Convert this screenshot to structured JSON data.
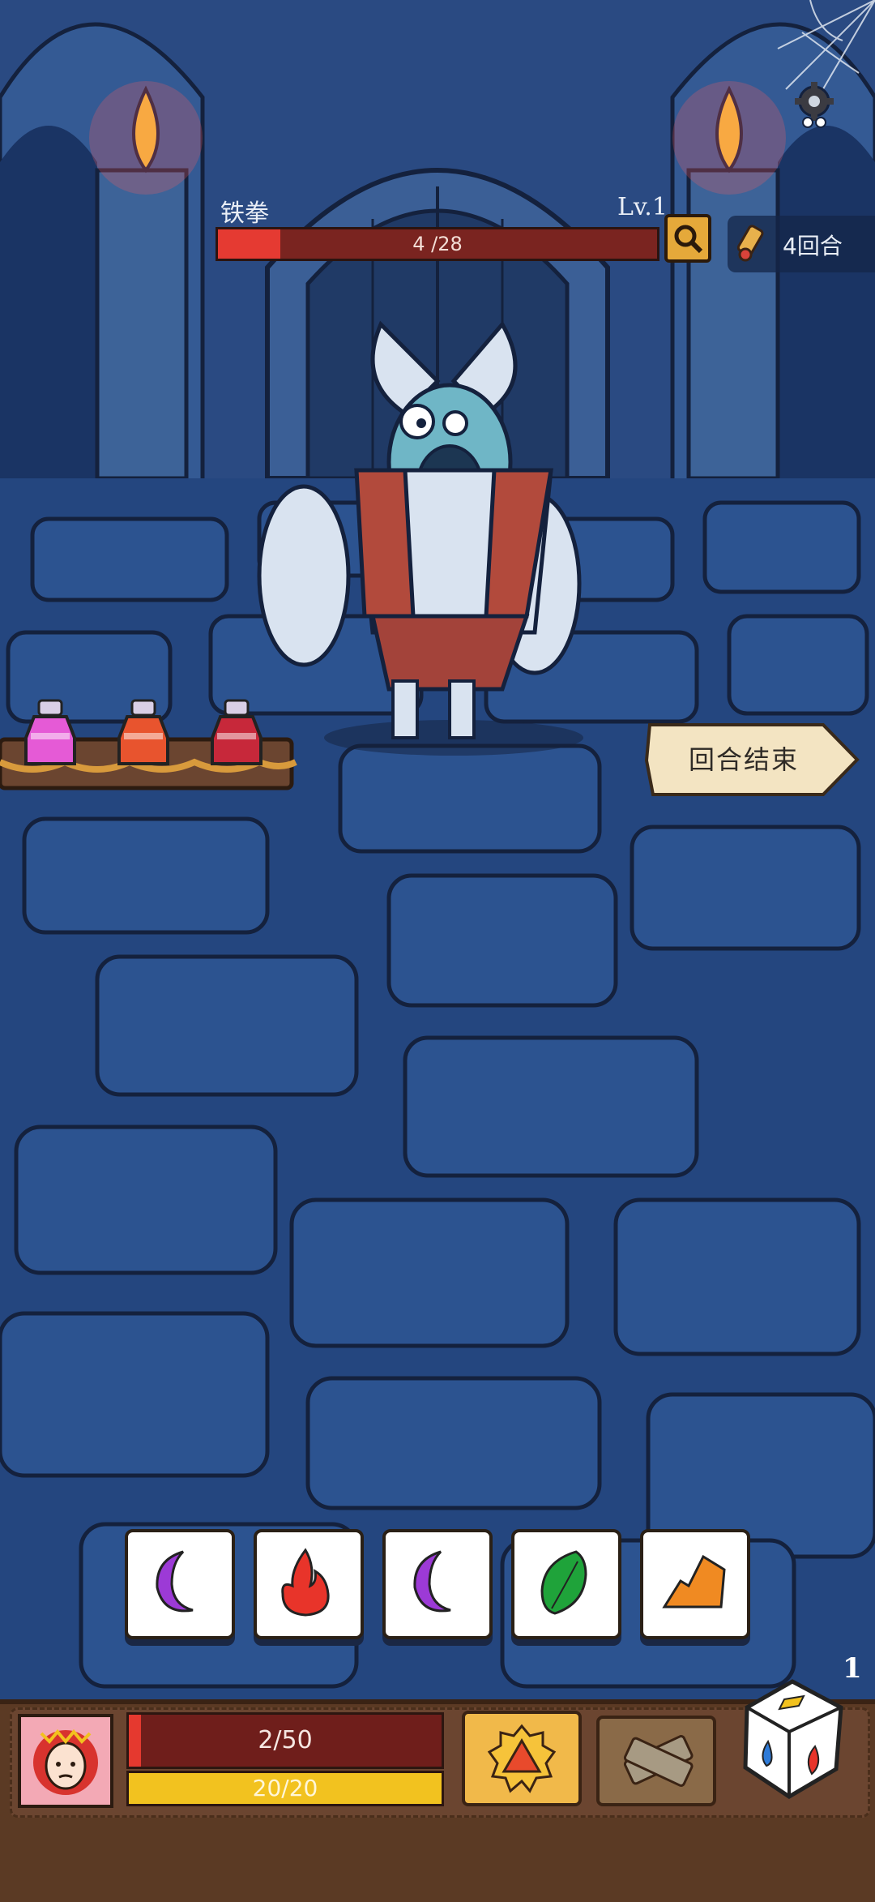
{
  "enemy": {
    "name": "铁拳",
    "level": "Lv.1",
    "hp_text": "4 /28",
    "hp_current": 4,
    "hp_max": 28,
    "hp_color": "#e53a32"
  },
  "rounds": {
    "label": "4回合"
  },
  "end_turn": {
    "label": "回合结束"
  },
  "dice_tiles": [
    {
      "symbol": "moon",
      "color": "#9c3ad6"
    },
    {
      "symbol": "fire",
      "color": "#e8342a"
    },
    {
      "symbol": "moon",
      "color": "#9c3ad6"
    },
    {
      "symbol": "leaf",
      "color": "#1fa33a"
    },
    {
      "symbol": "earth",
      "color": "#f08a22"
    }
  ],
  "potions": [
    {
      "name": "pink-potion",
      "color": "#e55ad6"
    },
    {
      "name": "orange-potion",
      "color": "#e8542e"
    },
    {
      "name": "red-potion",
      "color": "#c7283a"
    }
  ],
  "player": {
    "hp_text": "2/50",
    "hp_current": 2,
    "hp_max": 50,
    "energy_text": "20/20",
    "energy_current": 20,
    "energy_max": 20
  },
  "dice": {
    "count": "1"
  },
  "icons": {
    "settings": "gear-icon",
    "inspect": "magnifier-icon",
    "rounds": "scroll-icon",
    "skill_1": "d20-icon",
    "skill_2": "bandage-icon"
  }
}
